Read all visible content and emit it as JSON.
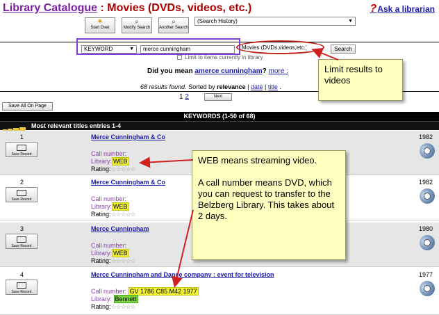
{
  "header": {
    "catalogue": "Library Catalogue",
    "separator": " : ",
    "section": "Movies (DVDs, videos, etc.)",
    "ask": "Ask a librarian"
  },
  "toolbar": {
    "start_over": "Start Over",
    "modify_search": "Modify Search",
    "another_search": "Another Search",
    "history": "(Search History)"
  },
  "search": {
    "type": "KEYWORD",
    "query": "merce cunningham",
    "material": "Movies (DVDs,videos,etc.)",
    "button": "Search",
    "limit_text": "Limit to items currently in library",
    "did_you_mean": "Did you mean",
    "suggestion": "amerce cunningham",
    "more": "more :",
    "results_count": "68 results found.",
    "sorted_by": "Sorted by",
    "sort_relevance": "relevance",
    "sep": " | ",
    "sort_date": "date",
    "sort_title": "title",
    "dot": " ."
  },
  "pager": {
    "page1": "1",
    "page2": "2",
    "next": "Next"
  },
  "save_all": "Save All On Page",
  "keywords_bar": "KEYWORDS (1-50 of 68)",
  "relevance_bar": "Most relevant titles entries 1-4",
  "callouts": {
    "limit": "Limit results to videos",
    "web_1": "WEB means streaming video.",
    "web_2": "A call number means DVD, which you can request to transfer to the Belzberg Library. This takes about 2 days."
  },
  "labels": {
    "call_number": "Call number:",
    "library": "Library:",
    "rating": "Rating:",
    "save_record": "Save Record"
  },
  "records": [
    {
      "num": "1",
      "title": "Merce Cunningham & Co",
      "call_number": "",
      "library": "WEB",
      "year": "1982"
    },
    {
      "num": "2",
      "title": "Merce Cunningham & Co",
      "call_number": "",
      "library": "WEB",
      "year": "1982"
    },
    {
      "num": "3",
      "title": "Merce Cunningham",
      "call_number": "",
      "library": "WEB",
      "year": "1980"
    },
    {
      "num": "4",
      "title": "Merce Cunningham and Dance company : event for television",
      "call_number": "GV 1786 C85 M42 1977",
      "library": "Bennett",
      "year": "1977"
    }
  ],
  "colors": {
    "highlight_yellow": "#f2f230",
    "highlight_green": "#7ed63a",
    "callout_bg": "#ffffc0",
    "arrow_red": "#d02020",
    "frame_purple": "#7b3fd6"
  }
}
